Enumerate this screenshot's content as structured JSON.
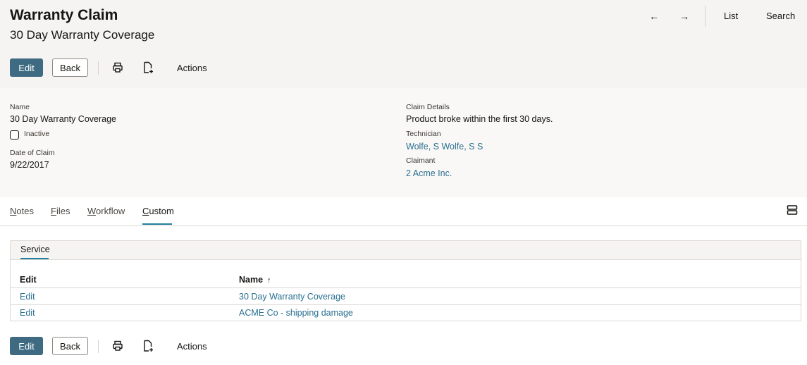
{
  "header": {
    "title": "Warranty Claim",
    "subtitle": "30 Day Warranty Coverage",
    "nav": {
      "back_arrow": "←",
      "forward_arrow": "→",
      "list_label": "List",
      "search_label": "Search"
    }
  },
  "toolbar_top": {
    "edit_label": "Edit",
    "back_label": "Back",
    "actions_label": "Actions"
  },
  "toolbar_bottom": {
    "edit_label": "Edit",
    "back_label": "Back",
    "actions_label": "Actions"
  },
  "fields": {
    "name_label": "Name",
    "name_value": "30 Day Warranty Coverage",
    "inactive_label": "Inactive",
    "inactive_checked": false,
    "date_label": "Date of Claim",
    "date_value": "9/22/2017",
    "claim_details_label": "Claim Details",
    "claim_details_value": "Product broke within the first 30 days.",
    "technician_label": "Technician",
    "technician_value": "Wolfe, S Wolfe, S S",
    "claimant_label": "Claimant",
    "claimant_value": "2 Acme Inc."
  },
  "tabs": [
    {
      "label": "Notes",
      "accel": "N",
      "rest": "otes"
    },
    {
      "label": "Files",
      "accel": "F",
      "rest": "iles"
    },
    {
      "label": "Workflow",
      "accel": "W",
      "rest": "orkflow"
    },
    {
      "label": "Custom",
      "accel": "C",
      "rest": "ustom",
      "active": true
    }
  ],
  "service_panel": {
    "tab_label": "Service",
    "columns": [
      "Edit",
      "Name"
    ],
    "sort_indicator": "↑",
    "rows": [
      {
        "edit": "Edit",
        "name": "30 Day Warranty Coverage"
      },
      {
        "edit": "Edit",
        "name": "ACME Co - shipping damage"
      }
    ]
  },
  "colors": {
    "primary_button": "#3e6b82",
    "link": "#2a6f8f",
    "tab_underline": "#227e9e",
    "header_bg": "#f5f4f2"
  },
  "icons": [
    "arrow-left-icon",
    "arrow-right-icon",
    "print-icon",
    "new-document-icon",
    "view-layout-icon",
    "sort-ascending-icon"
  ]
}
